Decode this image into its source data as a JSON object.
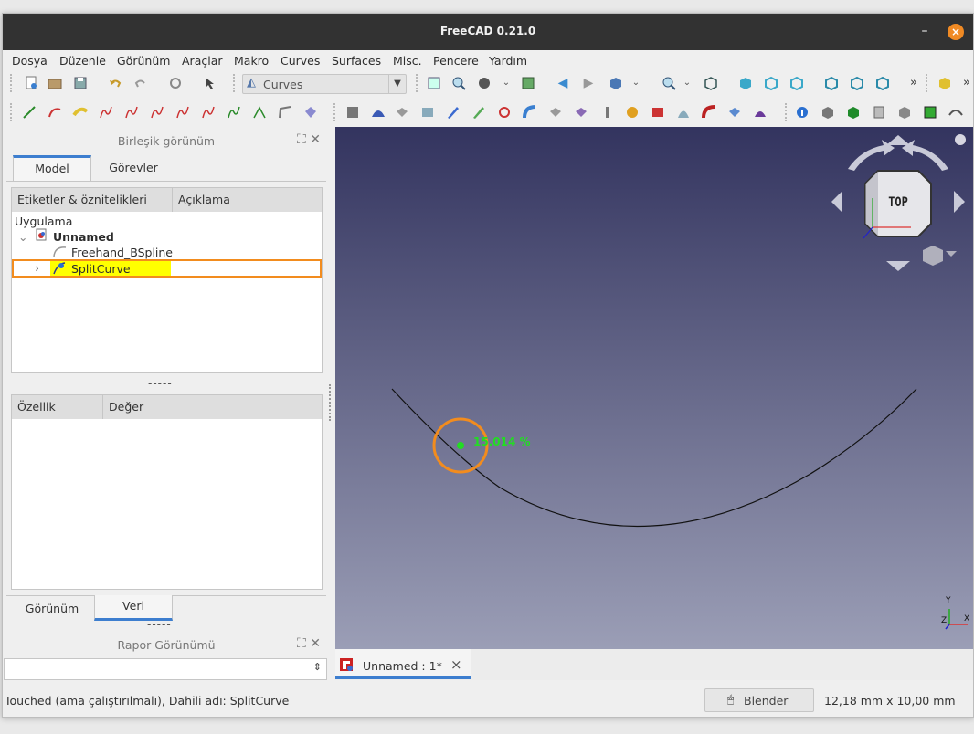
{
  "app": {
    "title": "FreeCAD 0.21.0"
  },
  "window_buttons": {
    "minimize": "–",
    "close": "×"
  },
  "menubar": {
    "items": [
      "Dosya",
      "Düzenle",
      "Görünüm",
      "Araçlar",
      "Makro",
      "Curves",
      "Surfaces",
      "Misc.",
      "Pencere",
      "Yardım"
    ]
  },
  "toolbar": {
    "workbench": "Curves",
    "overflow_1": "»",
    "overflow_2": "»"
  },
  "combo_view": {
    "title": "Birleşik görünüm",
    "tabs": [
      "Model",
      "Görevler"
    ],
    "active_tab": "Model",
    "tree_headers": [
      "Etiketler & öznitelikleri",
      "Açıklama"
    ],
    "tree": {
      "root": "Uygulama",
      "document": "Unnamed",
      "items": [
        "Freehand_BSpline",
        "SplitCurve"
      ],
      "selected": "SplitCurve"
    },
    "splitter": "-----",
    "property_headers": [
      "Özellik",
      "Değer"
    ],
    "bottom_tabs": [
      "Görünüm",
      "Veri"
    ],
    "active_bottom_tab": "Veri",
    "splitter_2": "-----"
  },
  "report_view": {
    "title": "Rapor Görünümü"
  },
  "viewport": {
    "curve_label": "15.014 %",
    "navcube_face": "TOP",
    "axis_x": "X",
    "axis_y": "Y",
    "axis_z": "Z"
  },
  "document_tab": {
    "label": "Unnamed : 1*",
    "close": "×"
  },
  "statusbar": {
    "message": "Touched (ama çalıştırılmalı), Dahili adı: SplitCurve",
    "navigation_style": "Blender",
    "dimensions": "12,18 mm x 10,00 mm"
  },
  "colors": {
    "titlebar": "#323232",
    "close_button": "#f08a24",
    "selection": "#ffff00",
    "highlight_box": "#f28c1e",
    "curve_point": "#22dd22",
    "tab_underline": "#3d7ecf"
  }
}
